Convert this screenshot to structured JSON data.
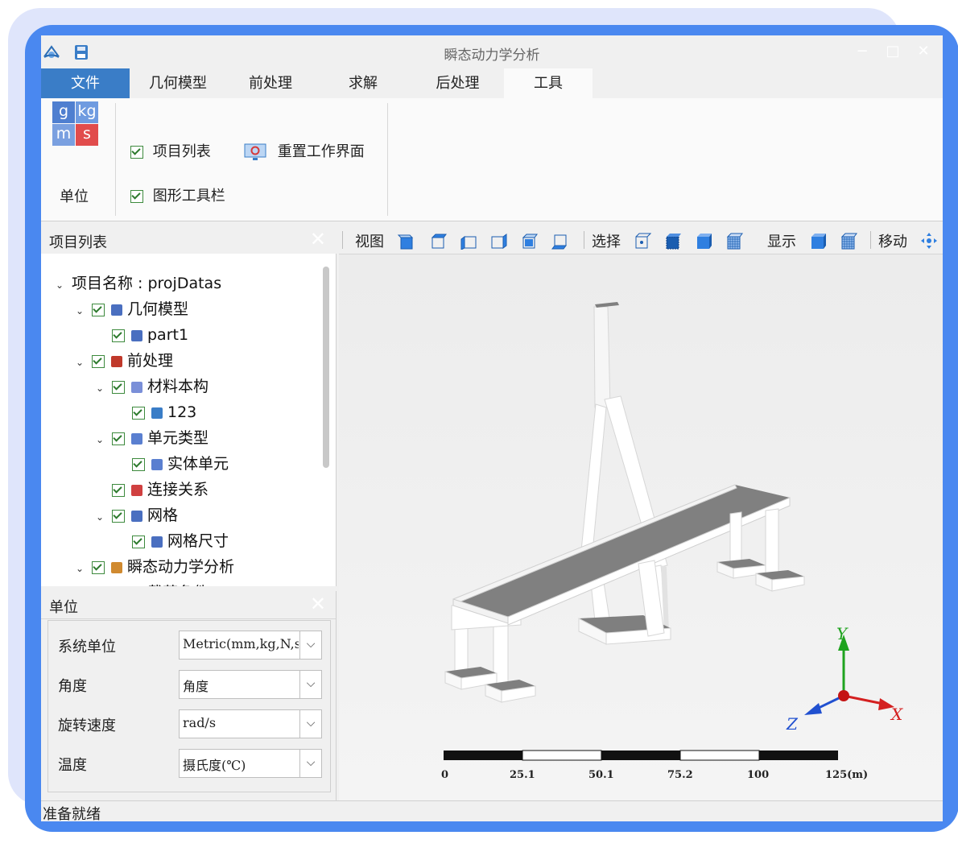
{
  "window": {
    "title": "瞬态动力学分析"
  },
  "tabs": [
    "文件",
    "几何模型",
    "前处理",
    "求解",
    "后处理",
    "工具"
  ],
  "ribbon": {
    "unit_icon_letters": [
      "g",
      "kg",
      "m",
      "s"
    ],
    "unit_button_label": "单位",
    "group_label": "单位",
    "check_project_list": "项目列表",
    "check_graphics_toolbar": "图形工具栏",
    "reset_workspace": "重置工作界面"
  },
  "project_panel": {
    "title": "项目列表",
    "tree": [
      {
        "label": "项目名称 : projDatas",
        "level": 0,
        "expand": true,
        "checkbox": false,
        "icon": ""
      },
      {
        "label": "几何模型",
        "level": 1,
        "expand": true,
        "checkbox": true,
        "icon": "geometry-icon"
      },
      {
        "label": "part1",
        "level": 2,
        "expand": false,
        "checkbox": true,
        "icon": "part-icon"
      },
      {
        "label": "前处理",
        "level": 1,
        "expand": true,
        "checkbox": true,
        "icon": "preprocess-icon"
      },
      {
        "label": "材料本构",
        "level": 2,
        "expand": true,
        "checkbox": true,
        "icon": "material-icon"
      },
      {
        "label": "123",
        "level": 3,
        "expand": false,
        "checkbox": true,
        "icon": "grid-icon"
      },
      {
        "label": "单元类型",
        "level": 2,
        "expand": true,
        "checkbox": true,
        "icon": "element-type-icon"
      },
      {
        "label": "实体单元",
        "level": 3,
        "expand": false,
        "checkbox": true,
        "icon": "solid-element-icon"
      },
      {
        "label": "连接关系",
        "level": 2,
        "expand": false,
        "checkbox": true,
        "icon": "connection-icon"
      },
      {
        "label": "网格",
        "level": 2,
        "expand": true,
        "checkbox": true,
        "icon": "mesh-icon"
      },
      {
        "label": "网格尺寸",
        "level": 3,
        "expand": false,
        "checkbox": true,
        "icon": "mesh-size-icon"
      },
      {
        "label": "瞬态动力学分析",
        "level": 1,
        "expand": true,
        "checkbox": true,
        "icon": "analysis-icon"
      },
      {
        "label": "载荷条件",
        "level": 2,
        "expand": false,
        "checkbox": true,
        "icon": "load-icon"
      }
    ]
  },
  "units_panel": {
    "title": "单位",
    "rows": [
      {
        "label": "系统单位",
        "value": "Metric(mm,kg,N,s"
      },
      {
        "label": "角度",
        "value": "角度"
      },
      {
        "label": "旋转速度",
        "value": "rad/s"
      },
      {
        "label": "温度",
        "value": "摄氏度(℃)"
      }
    ]
  },
  "view_toolbar": {
    "view_label": "视图",
    "select_label": "选择",
    "display_label": "显示",
    "move_label": "移动"
  },
  "viewport": {
    "axes": {
      "x": "X",
      "y": "Y",
      "z": "Z"
    },
    "scale_labels": [
      "0",
      "25.1",
      "50.1",
      "75.2",
      "100",
      "125(m)"
    ]
  },
  "status": {
    "text": "准备就绪"
  },
  "colors": {
    "accent": "#4a88f0",
    "file_tab": "#3a7dc7",
    "deck": "#7f7f7f"
  }
}
